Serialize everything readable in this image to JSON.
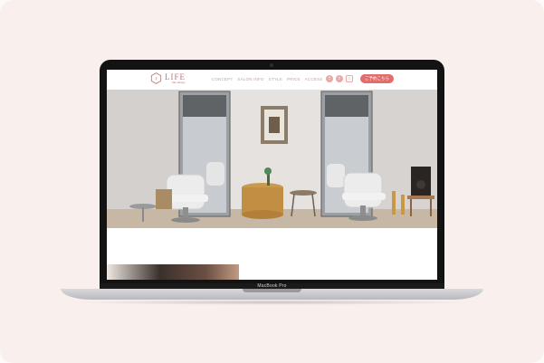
{
  "site": {
    "logo_name": "LIFE",
    "logo_sub": "hair design",
    "nav": [
      "CONCEPT",
      "SALON INFO",
      "STYLE",
      "PRICE",
      "ACCESS"
    ],
    "socials": [
      {
        "icon": "facebook-icon",
        "glyph": "f"
      },
      {
        "icon": "twitter-icon",
        "glyph": "t"
      },
      {
        "icon": "instagram-icon",
        "glyph": "◎"
      }
    ],
    "reserve_label": "ご予約こちら",
    "brand_color": "#e26d6b",
    "hero_alt": "salon interior"
  },
  "device": {
    "model_label": "MacBook Pro"
  }
}
